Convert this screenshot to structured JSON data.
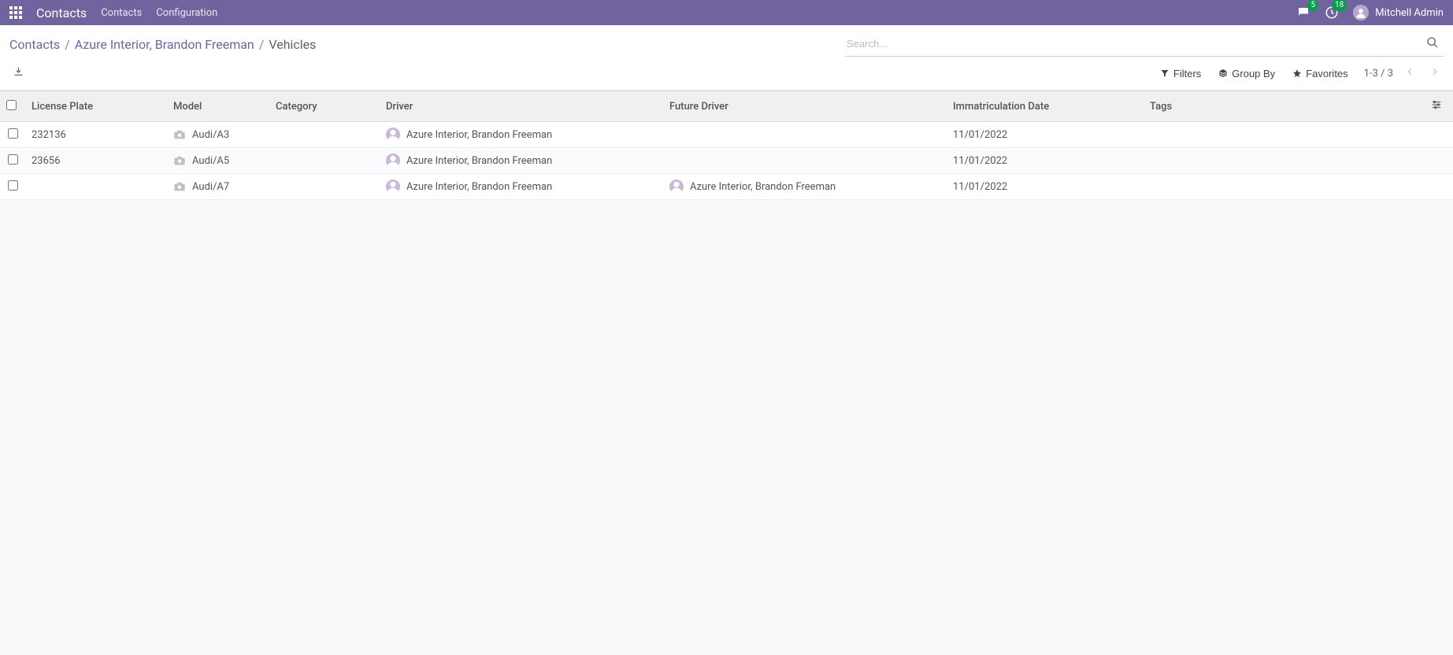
{
  "navbar": {
    "brand": "Contacts",
    "links": [
      "Contacts",
      "Configuration"
    ],
    "chat_badge": "5",
    "activity_badge": "18",
    "user_name": "Mitchell Admin"
  },
  "breadcrumb": {
    "items": [
      "Contacts",
      "Azure Interior, Brandon Freeman",
      "Vehicles"
    ]
  },
  "search": {
    "placeholder": "Search..."
  },
  "toolbar": {
    "filters_label": "Filters",
    "groupby_label": "Group By",
    "favorites_label": "Favorites",
    "pager_text": "1-3 / 3"
  },
  "table": {
    "headers": {
      "license_plate": "License Plate",
      "model": "Model",
      "category": "Category",
      "driver": "Driver",
      "future_driver": "Future Driver",
      "immat_date": "Immatriculation Date",
      "tags": "Tags"
    },
    "rows": [
      {
        "license_plate": "232136",
        "model": "Audi/A3",
        "category": "",
        "driver": "Azure Interior, Brandon Freeman",
        "future_driver": "",
        "immat_date": "11/01/2022",
        "tags": ""
      },
      {
        "license_plate": "23656",
        "model": "Audi/A5",
        "category": "",
        "driver": "Azure Interior, Brandon Freeman",
        "future_driver": "",
        "immat_date": "11/01/2022",
        "tags": ""
      },
      {
        "license_plate": "",
        "model": "Audi/A7",
        "category": "",
        "driver": "Azure Interior, Brandon Freeman",
        "future_driver": "Azure Interior, Brandon Freeman",
        "immat_date": "11/01/2022",
        "tags": ""
      }
    ]
  }
}
